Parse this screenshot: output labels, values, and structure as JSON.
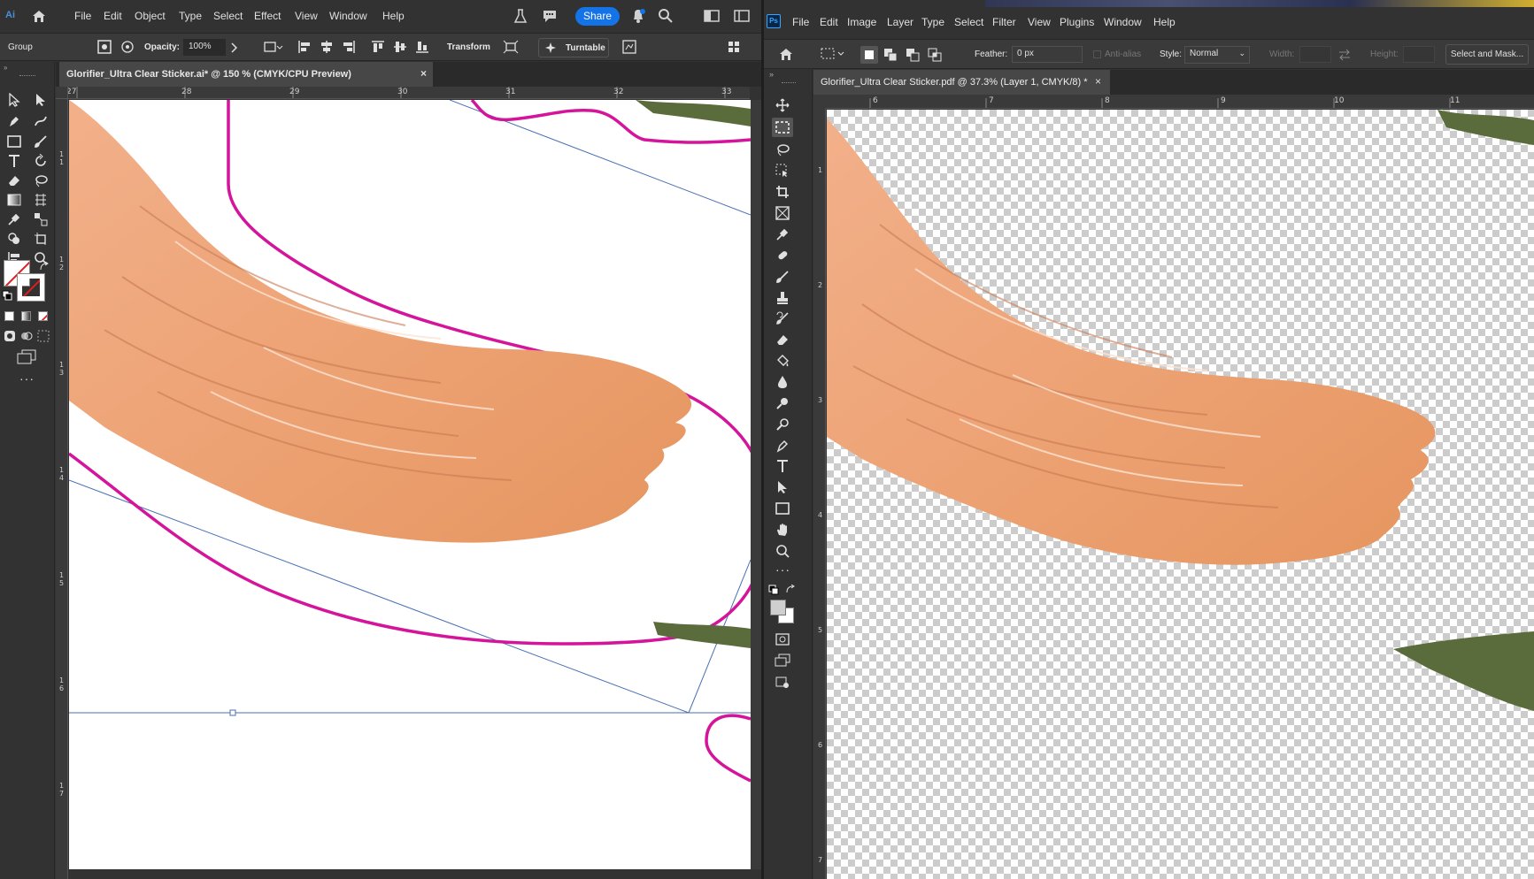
{
  "illustrator": {
    "app_icon": "ai-logo-icon",
    "menu": [
      "File",
      "Edit",
      "Object",
      "Type",
      "Select",
      "Effect",
      "View",
      "Window",
      "Help"
    ],
    "share_label": "Share",
    "control_bar": {
      "selection_label": "Group",
      "opacity_label": "Opacity:",
      "opacity_value": "100%",
      "transform_label": "Transform",
      "turntable_label": "Turntable"
    },
    "document_tab": "Glorifier_Ultra Clear Sticker.ai* @ 150 % (CMYK/CPU Preview)",
    "ruler_top": [
      "27",
      "28",
      "29",
      "30",
      "31",
      "32",
      "33"
    ],
    "ruler_left": [
      "1",
      "1",
      "1",
      "1",
      "1",
      "1",
      "1"
    ],
    "ruler_left_sub": [
      "1",
      "2",
      "3",
      "4",
      "5",
      "6",
      "7"
    ],
    "colors": {
      "cut_line": "#d4149a",
      "brush": "#ecA070",
      "guide": "#4a6fb3",
      "accent": "#1473e6"
    }
  },
  "photoshop": {
    "app_icon": "ps-logo-icon",
    "app_badge": "Ps",
    "menu": [
      "File",
      "Edit",
      "Image",
      "Layer",
      "Type",
      "Select",
      "Filter",
      "View",
      "Plugins",
      "Window",
      "Help"
    ],
    "options": {
      "feather_label": "Feather:",
      "feather_value": "0 px",
      "anti_alias_label": "Anti-alias",
      "style_label": "Style:",
      "style_value": "Normal",
      "width_label": "Width:",
      "height_label": "Height:",
      "select_mask_label": "Select and Mask..."
    },
    "document_tab": "Glorifier_Ultra Clear Sticker.pdf @ 37.3% (Layer 1, CMYK/8) *",
    "ruler_top": [
      "6",
      "7",
      "8",
      "9",
      "10",
      "11"
    ],
    "ruler_left": [
      "1",
      "2",
      "3",
      "4",
      "5",
      "6",
      "7"
    ]
  }
}
